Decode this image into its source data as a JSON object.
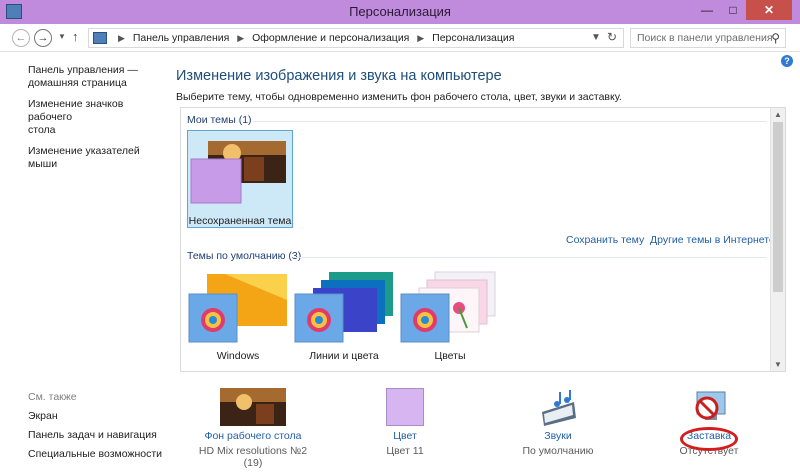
{
  "window": {
    "title": "Персонализация",
    "min_glyph": "—",
    "max_glyph": "□",
    "close_glyph": "✕"
  },
  "address": {
    "crumbs": [
      "Панель управления",
      "Оформление и персонализация",
      "Персонализация"
    ],
    "search_placeholder": "Поиск в панели управления"
  },
  "left_nav": {
    "home_line1": "Панель управления —",
    "home_line2": "домашняя страница",
    "icons_line1": "Изменение значков рабочего",
    "icons_line2": "стола",
    "pointers": "Изменение указателей мыши"
  },
  "see_also": {
    "header": "См. также",
    "items": [
      "Экран",
      "Панель задач и навигация",
      "Специальные возможности"
    ]
  },
  "main": {
    "heading": "Изменение изображения и звука на компьютере",
    "subhead": "Выберите тему, чтобы одновременно изменить фон рабочего стола, цвет, звуки и заставку.",
    "my_themes_header": "Мои темы (1)",
    "unsaved_theme": "Несохраненная тема",
    "save_theme": "Сохранить тему",
    "more_themes": "Другие темы в Интернете",
    "default_themes_header": "Темы по умолчанию (3)",
    "default_themes": [
      "Windows",
      "Линии и цвета",
      "Цветы"
    ]
  },
  "bottom": {
    "wallpaper": {
      "label": "Фон рабочего стола",
      "value": "HD Mix resolutions №2 (19)"
    },
    "color": {
      "label": "Цвет",
      "value": "Цвет 11"
    },
    "sounds": {
      "label": "Звуки",
      "value": "По умолчанию"
    },
    "screensaver": {
      "label": "Заставка",
      "value": "Отсутствует"
    }
  },
  "colors": {
    "titlebar": "#c08bdc",
    "accent_swatch": "#d7b5f0",
    "link": "#1f5ea8",
    "highlight_oval": "#d51d1d"
  }
}
